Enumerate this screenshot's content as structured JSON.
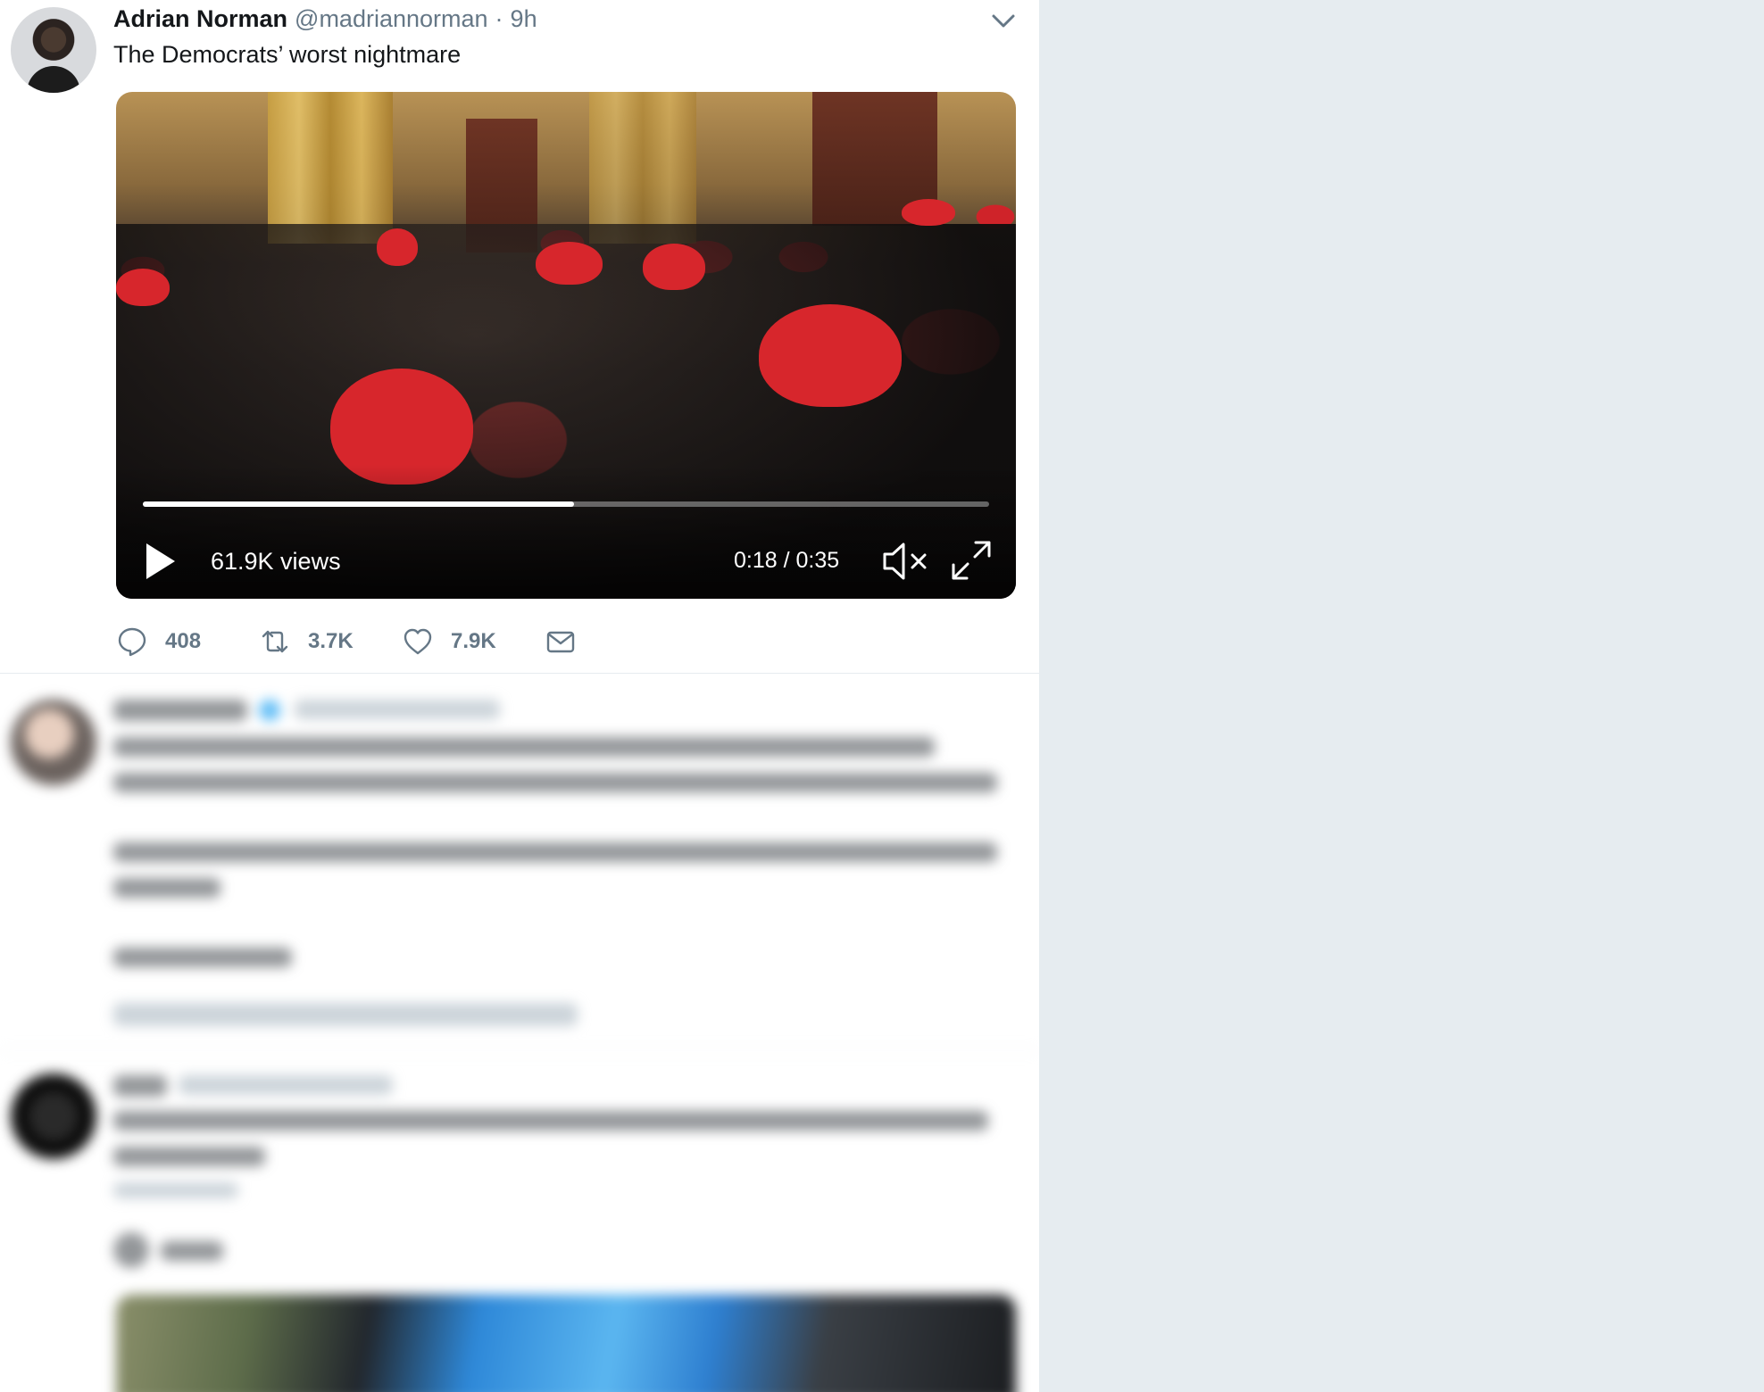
{
  "tweet": {
    "author_name": "Adrian Norman",
    "author_handle": "@madriannorman",
    "separator": "·",
    "time": "9h",
    "text": "The Democrats’ worst nightmare",
    "video": {
      "views": "61.9K views",
      "elapsed": "0:18",
      "duration": "0:35",
      "time_display": "0:18 / 0:35",
      "progress": 0.51,
      "muted": true
    },
    "actions": {
      "replies": "408",
      "retweets": "3.7K",
      "likes": "7.9K"
    }
  },
  "colors": {
    "timeline_bg": "#ffffff",
    "page_bg": "#e6ecf0",
    "secondary_text": "#657786",
    "primary_text": "#14171a",
    "verified_blue": "#1da1f2"
  },
  "icons": {
    "caret": "chevron-down-icon",
    "reply": "reply-icon",
    "retweet": "retweet-icon",
    "like": "heart-icon",
    "dm": "envelope-icon",
    "play": "play-icon",
    "mute": "muted-speaker-icon",
    "fullscreen": "fullscreen-icon"
  }
}
